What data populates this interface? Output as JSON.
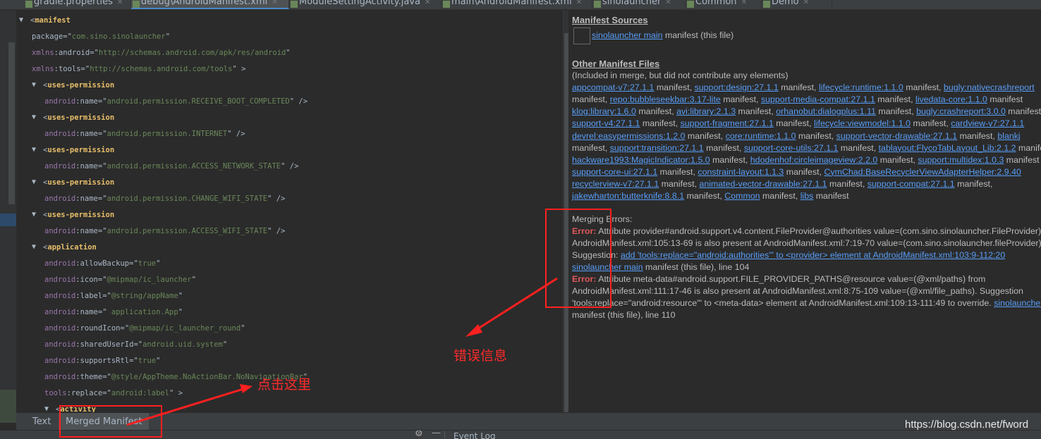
{
  "tabs": [
    {
      "label": "gradle.properties",
      "active": false
    },
    {
      "label": "debug\\AndroidManifest.xml",
      "active": true
    },
    {
      "label": "ModuleSettingActivity.java",
      "active": false
    },
    {
      "label": "main\\AndroidManifest.xml",
      "active": false
    },
    {
      "label": "sinolauncher",
      "active": false
    },
    {
      "label": "Common",
      "active": false
    },
    {
      "label": "Demo",
      "active": false
    }
  ],
  "editor": {
    "lines": [
      {
        "i": 0,
        "tag": "manifest"
      },
      {
        "i": 1,
        "ns": "",
        "attr": "package",
        "val": "com.sino.sinolauncher",
        "end": ""
      },
      {
        "i": 1,
        "ns": "xmlns",
        "attr": "android",
        "val": "http://schemas.android.com/apk/res/android",
        "end": ""
      },
      {
        "i": 1,
        "ns": "xmlns",
        "attr": "tools",
        "val": "http://schemas.android.com/tools",
        "end": " >"
      },
      {
        "i": 1,
        "tag": "uses-permission"
      },
      {
        "i": 2,
        "ns": "android",
        "attr": "name",
        "val": "android.permission.RECEIVE_BOOT_COMPLETED",
        "end": " />"
      },
      {
        "i": 1,
        "tag": "uses-permission"
      },
      {
        "i": 2,
        "ns": "android",
        "attr": "name",
        "val": "android.permission.INTERNET",
        "end": " />"
      },
      {
        "i": 1,
        "tag": "uses-permission"
      },
      {
        "i": 2,
        "ns": "android",
        "attr": "name",
        "val": "android.permission.ACCESS_NETWORK_STATE",
        "end": " />"
      },
      {
        "i": 1,
        "tag": "uses-permission"
      },
      {
        "i": 2,
        "ns": "android",
        "attr": "name",
        "val": "android.permission.CHANGE_WIFI_STATE",
        "end": " />"
      },
      {
        "i": 1,
        "tag": "uses-permission"
      },
      {
        "i": 2,
        "ns": "android",
        "attr": "name",
        "val": "android.permission.ACCESS_WIFI_STATE",
        "end": " />"
      },
      {
        "i": 1,
        "tag": "application"
      },
      {
        "i": 2,
        "ns": "android",
        "attr": "allowBackup",
        "val": "true",
        "end": ""
      },
      {
        "i": 2,
        "ns": "android",
        "attr": "icon",
        "val": "@mipmap/ic_launcher",
        "end": ""
      },
      {
        "i": 2,
        "ns": "android",
        "attr": "label",
        "val": "@string/appName",
        "end": ""
      },
      {
        "i": 2,
        "ns": "android",
        "attr": "name",
        "val": " application.App",
        "end": ""
      },
      {
        "i": 2,
        "ns": "android",
        "attr": "roundIcon",
        "val": "@mipmap/ic_launcher_round",
        "end": ""
      },
      {
        "i": 2,
        "ns": "android",
        "attr": "sharedUserId",
        "val": "android.uid.system",
        "end": ""
      },
      {
        "i": 2,
        "ns": "android",
        "attr": "supportsRtl",
        "val": "true",
        "end": ""
      },
      {
        "i": 2,
        "ns": "android",
        "attr": "theme",
        "val": "@style/AppTheme.NoActionBar.NoNavigationBar",
        "end": ""
      },
      {
        "i": 2,
        "ns": "tools",
        "attr": "replace",
        "val": "android:label",
        "end": " >"
      },
      {
        "i": 2,
        "tag": "activity"
      }
    ]
  },
  "right": {
    "sources_title": "Manifest Sources",
    "sources_line": [
      {
        "t": "sinolauncher main",
        "l": 1
      },
      {
        "t": " manifest (this file)"
      }
    ],
    "other_title": "Other Manifest Files",
    "lines": [
      [
        {
          "t": "(Included in merge, but did not contribute any elements)"
        }
      ],
      [
        {
          "t": "appcompat-v7:27.1.1",
          "l": 1
        },
        {
          "t": " manifest, "
        },
        {
          "t": "support:design:27.1.1",
          "l": 1
        },
        {
          "t": " manifest, "
        },
        {
          "t": "lifecycle:runtime:1.1.0",
          "l": 1
        },
        {
          "t": " manifest, "
        },
        {
          "t": "bugly:nativecrashreport",
          "l": 1
        }
      ],
      [
        {
          "t": "manifest, "
        },
        {
          "t": "repo:bubbleseekbar:3.17-lite",
          "l": 1
        },
        {
          "t": " manifest, "
        },
        {
          "t": "support-media-compat:27.1.1",
          "l": 1
        },
        {
          "t": " manifest, "
        },
        {
          "t": "livedata-core:1.1.0",
          "l": 1
        },
        {
          "t": " manifest"
        }
      ],
      [
        {
          "t": "klog:library:1.6.0",
          "l": 1
        },
        {
          "t": " manifest, "
        },
        {
          "t": "avi:library:2.1.3",
          "l": 1
        },
        {
          "t": " manifest, "
        },
        {
          "t": "orhanobut:dialogplus:1.11",
          "l": 1
        },
        {
          "t": " manifest, "
        },
        {
          "t": "bugly:crashreport:3.0.0",
          "l": 1
        },
        {
          "t": " manifest"
        }
      ],
      [
        {
          "t": "support-v4:27.1.1",
          "l": 1
        },
        {
          "t": " manifest, "
        },
        {
          "t": "support-fragment:27.1.1",
          "l": 1
        },
        {
          "t": " manifest, "
        },
        {
          "t": "lifecycle:viewmodel:1.1.0",
          "l": 1
        },
        {
          "t": " manifest, "
        },
        {
          "t": "cardview-v7:27.1.1",
          "l": 1
        }
      ],
      [
        {
          "t": "devrel:easypermissions:1.2.0",
          "l": 1
        },
        {
          "t": " manifest, "
        },
        {
          "t": "core:runtime:1.1.0",
          "l": 1
        },
        {
          "t": " manifest, "
        },
        {
          "t": "support-vector-drawable:27.1.1",
          "l": 1
        },
        {
          "t": " manifest, "
        },
        {
          "t": "blankj",
          "l": 1
        }
      ],
      [
        {
          "t": "manifest, "
        },
        {
          "t": "support:transition:27.1.1",
          "l": 1
        },
        {
          "t": " manifest, "
        },
        {
          "t": "support-core-utils:27.1.1",
          "l": 1
        },
        {
          "t": " manifest, "
        },
        {
          "t": "tablayout:FlycoTabLayout_Lib:2.1.2",
          "l": 1
        },
        {
          "t": " manifest"
        }
      ],
      [
        {
          "t": "hackware1993:MagicIndicator:1.5.0",
          "l": 1
        },
        {
          "t": " manifest, "
        },
        {
          "t": "hdodenhof:circleimageview:2.2.0",
          "l": 1
        },
        {
          "t": " manifest, "
        },
        {
          "t": "support:multidex:1.0.3",
          "l": 1
        },
        {
          "t": " manifest"
        }
      ],
      [
        {
          "t": "support-core-ui:27.1.1",
          "l": 1
        },
        {
          "t": " manifest, "
        },
        {
          "t": "constraint-layout:1.1.3",
          "l": 1
        },
        {
          "t": " manifest, "
        },
        {
          "t": "CymChad:BaseRecyclerViewAdapterHelper:2.9.40",
          "l": 1
        }
      ],
      [
        {
          "t": "recyclerview-v7:27.1.1",
          "l": 1
        },
        {
          "t": " manifest, "
        },
        {
          "t": "animated-vector-drawable:27.1.1",
          "l": 1
        },
        {
          "t": " manifest, "
        },
        {
          "t": "support-compat:27.1.1",
          "l": 1
        },
        {
          "t": " manifest,"
        }
      ],
      [
        {
          "t": "jakewharton:butterknife:8.8.1",
          "l": 1
        },
        {
          "t": " manifest, "
        },
        {
          "t": "Common",
          "l": 1
        },
        {
          "t": " manifest, "
        },
        {
          "t": "libs",
          "l": 1
        },
        {
          "t": " manifest"
        }
      ]
    ],
    "errors": [
      [
        {
          "t": "Merging Errors:"
        }
      ],
      [
        {
          "t": "Error:",
          "e": 1
        },
        {
          "t": " Attribute provider#android.support.v4.content.FileProvider@authorities value=(com.sino.sinolauncher.FileProvider)"
        }
      ],
      [
        {
          "t": "AndroidManifest.xml:105:13-69 is also present at AndroidManifest.xml:7:19-70 value=(com.sino.sinolauncher.fileProvider)"
        }
      ],
      [
        {
          "t": "Suggestion: "
        },
        {
          "t": "add 'tools:replace=\"android:authorities\"' to <provider> element at AndroidManifest.xml:103:9-112:20",
          "l": 1
        }
      ],
      [
        {
          "t": "sinolauncher main",
          "l": 1
        },
        {
          "t": " manifest (this file), line 104"
        }
      ],
      [
        {
          "t": "Error:",
          "e": 1
        },
        {
          "t": " Attribute meta-data#android.support.FILE_PROVIDER_PATHS@resource value=(@xml/paths) from"
        }
      ],
      [
        {
          "t": "AndroidManifest.xml:111:17-46 is also present at AndroidManifest.xml:8:75-109 value=(@xml/file_paths). Suggestion"
        }
      ],
      [
        {
          "t": "'tools:replace=\"android:resource\"' to <meta-data> element at AndroidManifest.xml:109:13-111:49 to override. "
        },
        {
          "t": "sinolauncher",
          "l": 1
        }
      ],
      [
        {
          "t": "manifest (this file), line 110"
        }
      ]
    ]
  },
  "bottom_tabs": [
    {
      "label": "Text",
      "active": false
    },
    {
      "label": "Merged Manifest",
      "active": true
    }
  ],
  "status": {
    "event_log": "Event Log"
  },
  "annotations": {
    "error_info": "错误信息",
    "click_here": "点击这里",
    "color": "#ff2020"
  },
  "watermark": "https://blog.csdn.net/fword",
  "colors": {
    "tag": "#e8bf6a",
    "namespace": "#9876aa",
    "value": "#6a8759",
    "link": "#589df6",
    "error": "#e0575a"
  }
}
